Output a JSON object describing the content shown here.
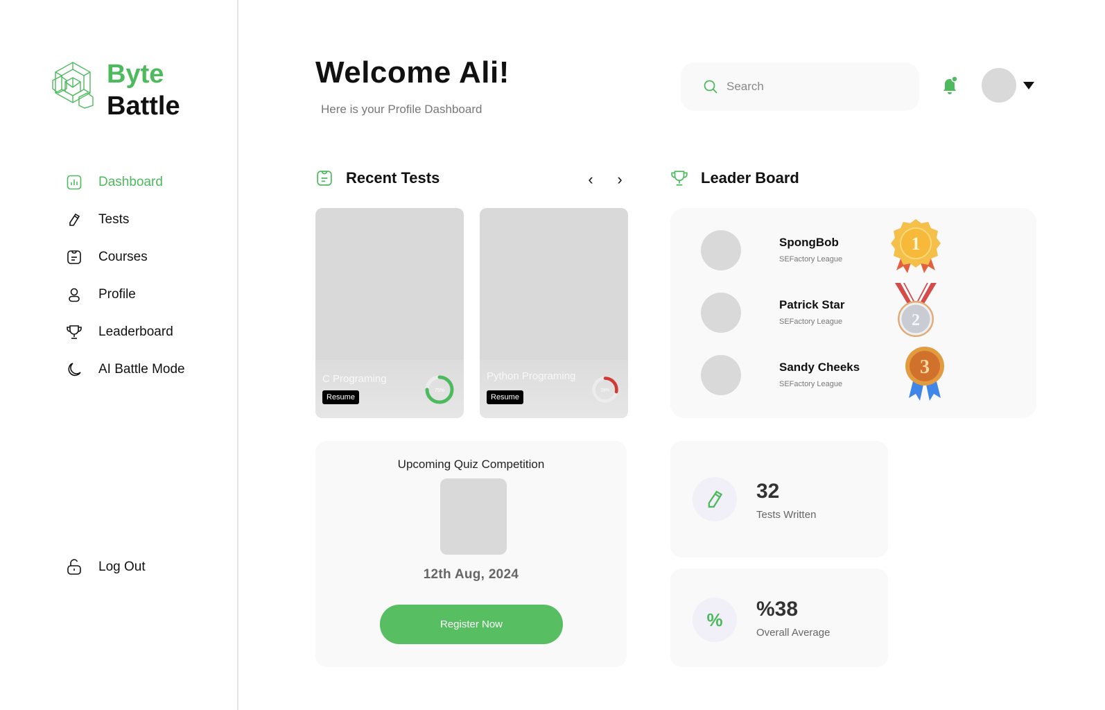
{
  "brand": {
    "line1": "Byte",
    "line2": "Battle",
    "accent": "#4cba5d"
  },
  "sidebar": {
    "items": [
      {
        "label": "Dashboard",
        "icon": "dashboard-icon",
        "active": true
      },
      {
        "label": "Tests",
        "icon": "pencil-icon"
      },
      {
        "label": "Courses",
        "icon": "clipboard-icon"
      },
      {
        "label": "Profile",
        "icon": "user-icon"
      },
      {
        "label": "Leaderboard",
        "icon": "trophy-icon"
      },
      {
        "label": "AI Battle Mode",
        "icon": "moon-icon"
      }
    ],
    "logout": "Log Out"
  },
  "header": {
    "title": "Welcome Ali!",
    "subtitle": "Here is your Profile Dashboard",
    "search_placeholder": "Search"
  },
  "recent_tests": {
    "title": "Recent Tests",
    "prev": "‹",
    "next": "›",
    "cards": [
      {
        "name": "C Programing",
        "button": "Resume",
        "progress": 0.75,
        "progress_label": "75%",
        "color": "#4cba5d"
      },
      {
        "name": "Python Programing",
        "button": "Resume",
        "progress": 0.28,
        "progress_label": "28%",
        "color": "#d03a30"
      }
    ]
  },
  "leaderboard": {
    "title": "Leader Board",
    "entries": [
      {
        "name": "SpongBob",
        "league": "SEFactory League",
        "medal": "gold-medal-icon",
        "rank": "1"
      },
      {
        "name": "Patrick Star",
        "league": "SEFactory League",
        "medal": "silver-medal-icon",
        "rank": "2"
      },
      {
        "name": "Sandy Cheeks",
        "league": "SEFactory League",
        "medal": "bronze-medal-icon",
        "rank": "3"
      }
    ]
  },
  "quiz": {
    "title": "Upcoming Quiz Competition",
    "date": "12th Aug, 2024",
    "button": "Register Now"
  },
  "stats": [
    {
      "value": "32",
      "label": "Tests Written",
      "icon": "pencil-icon"
    },
    {
      "value": "%38",
      "label": "Overall Average",
      "icon": "percent-icon",
      "symbol": "%"
    }
  ]
}
